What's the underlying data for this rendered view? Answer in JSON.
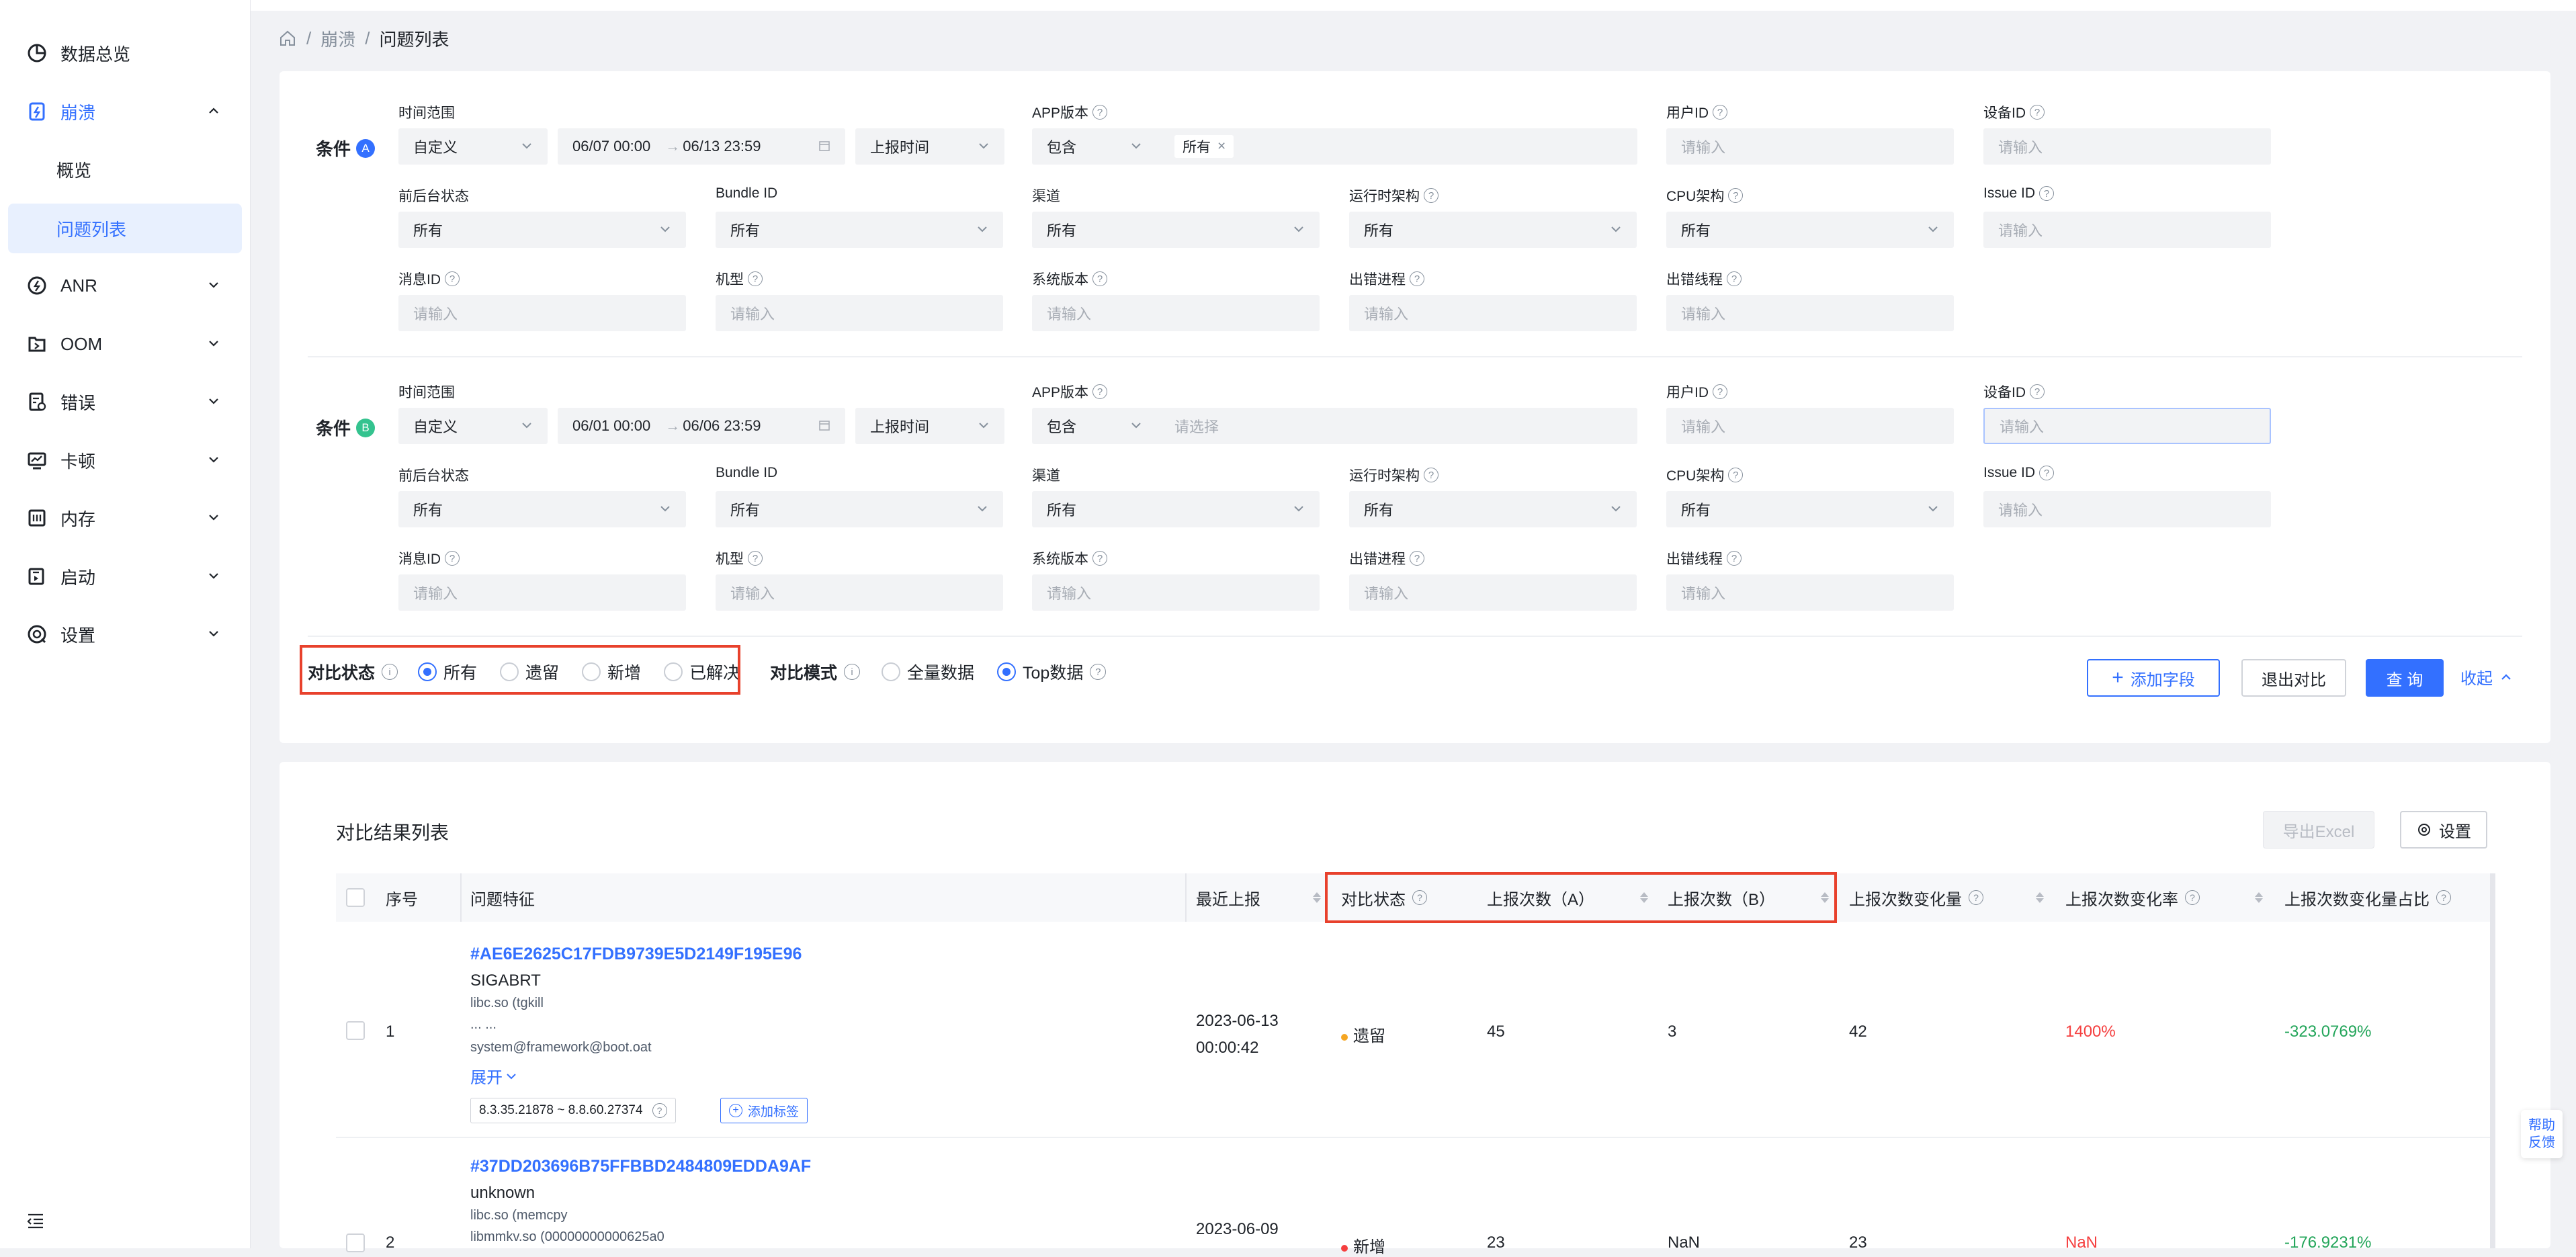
{
  "sidebar": {
    "items": [
      {
        "label": "数据总览",
        "icon": "pie-chart-icon"
      },
      {
        "label": "崩溃",
        "icon": "crash-icon"
      },
      {
        "label": "概览"
      },
      {
        "label": "问题列表"
      },
      {
        "label": "ANR",
        "icon": "anr-icon"
      },
      {
        "label": "OOM",
        "icon": "oom-icon"
      },
      {
        "label": "错误",
        "icon": "error-icon"
      },
      {
        "label": "卡顿",
        "icon": "lag-icon"
      },
      {
        "label": "内存",
        "icon": "memory-icon"
      },
      {
        "label": "启动",
        "icon": "launch-icon"
      },
      {
        "label": "设置",
        "icon": "settings-icon"
      }
    ]
  },
  "breadcrumb": {
    "sep": "/",
    "level1": "崩溃",
    "level2": "问题列表"
  },
  "labels": {
    "time_range": "时间范围",
    "app_version": "APP版本",
    "user_id": "用户ID",
    "device_id": "设备ID",
    "fg_bg": "前后台状态",
    "bundle_id": "Bundle ID",
    "channel": "渠道",
    "runtime_arch": "运行时架构",
    "cpu_arch": "CPU架构",
    "issue_id": "Issue ID",
    "msg_id": "消息ID",
    "model": "机型",
    "os_version": "系统版本",
    "err_process": "出错进程",
    "err_thread": "出错线程"
  },
  "common": {
    "custom": "自定义",
    "report_time": "上报时间",
    "contains": "包含",
    "all": "所有",
    "placeholder": "请输入",
    "select_placeholder": "请选择",
    "arrow": "→"
  },
  "condA": {
    "title": "条件",
    "badge": "A",
    "date_start": "06/07 00:00",
    "date_end": "06/13 23:59",
    "app_tag": "所有"
  },
  "condB": {
    "title": "条件",
    "badge": "B",
    "date_start": "06/01 00:00",
    "date_end": "06/06 23:59"
  },
  "compare": {
    "status_label": "对比状态",
    "status_options": [
      "所有",
      "遗留",
      "新增",
      "已解决"
    ],
    "mode_label": "对比模式",
    "mode_options": [
      "全量数据",
      "Top数据"
    ]
  },
  "actions": {
    "add_field": "添加字段",
    "exit_compare": "退出对比",
    "query": "查 询",
    "collapse": "收起"
  },
  "results": {
    "title": "对比结果列表",
    "export": "导出Excel",
    "settings": "设置",
    "columns": [
      "序号",
      "问题特征",
      "最近上报",
      "对比状态",
      "上报次数（A）",
      "上报次数（B）",
      "上报次数变化量",
      "上报次数变化率",
      "上报次数变化量占比"
    ],
    "rows": [
      {
        "index": "1",
        "hash": "#AE6E2625C17FDB9739E5D2149F195E96",
        "type": "SIGABRT",
        "line1": "libc.so (tgkill",
        "line2": "... ...",
        "line3": "system@framework@boot.oat",
        "expand": "展开",
        "version": "8.3.35.21878 ~ 8.8.60.27374",
        "add_tag": "添加标签",
        "date": "2023-06-13",
        "time": "00:00:42",
        "status": "遗留",
        "a": "45",
        "b": "3",
        "delta": "42",
        "rate": "1400%",
        "share": "-323.0769%"
      },
      {
        "index": "2",
        "hash": "#37DD203696B75FFBBD2484809EDDA9AF",
        "type": "unknown",
        "line1": "libc.so (memcpy",
        "line2": "libmmkv.so (00000000000625a0",
        "date": "2023-06-09",
        "status": "新增",
        "a": "23",
        "b": "NaN",
        "delta": "23",
        "rate": "NaN",
        "share": "-176.9231%"
      }
    ]
  },
  "help": {
    "line1": "帮助",
    "line2": "反馈"
  },
  "colors": {
    "accent": "#3370ff",
    "highlight": "#e8412c",
    "red": "#f53f3f",
    "green": "#23a55a",
    "status_legacy": "#f5a623",
    "status_new": "#f53f3f"
  }
}
